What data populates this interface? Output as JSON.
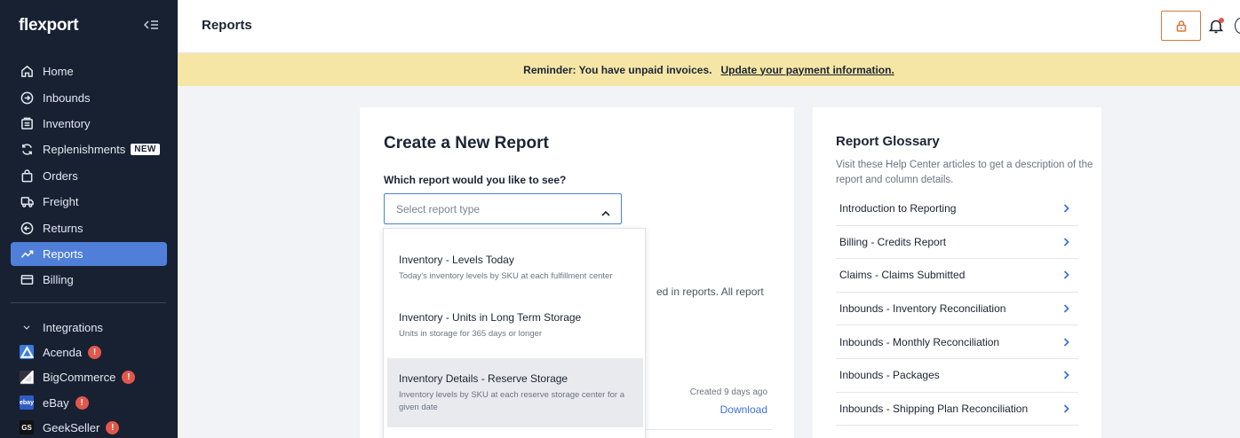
{
  "app": {
    "brand": "flexport"
  },
  "header": {
    "title": "Reports"
  },
  "banner": {
    "text": "Reminder: You have unpaid invoices.",
    "link": "Update your payment information."
  },
  "sidebar": {
    "items": [
      {
        "label": "Home",
        "icon": "home-icon"
      },
      {
        "label": "Inbounds",
        "icon": "inbound-icon"
      },
      {
        "label": "Inventory",
        "icon": "inventory-icon"
      },
      {
        "label": "Replenishments",
        "icon": "replenish-icon",
        "badge": "NEW"
      },
      {
        "label": "Orders",
        "icon": "bag-icon"
      },
      {
        "label": "Freight",
        "icon": "truck-icon"
      },
      {
        "label": "Returns",
        "icon": "returns-icon"
      },
      {
        "label": "Reports",
        "icon": "trend-icon",
        "active": true
      },
      {
        "label": "Billing",
        "icon": "card-icon"
      }
    ],
    "integrations_label": "Integrations",
    "integrations": [
      {
        "label": "Acenda",
        "logo_color": "#3b7de0"
      },
      {
        "label": "BigCommerce",
        "logo_color": "#34313f"
      },
      {
        "label": "eBay",
        "logo_color": "#2f5cc8"
      },
      {
        "label": "GeekSeller",
        "logo_text": "GS",
        "logo_color": "#111111"
      }
    ],
    "alert_mark": "!"
  },
  "create": {
    "title": "Create a New Report",
    "question": "Which report would you like to see?",
    "placeholder": "Select report type",
    "peek_text": "ed in reports. All report",
    "created": "Created 9 days ago",
    "download": "Download"
  },
  "dropdown": {
    "options": [
      {
        "title": "Inventory - Levels Today",
        "desc": "Today's inventory levels by SKU at each fulfillment center"
      },
      {
        "title": "Inventory - Units in Long Term Storage",
        "desc": "Units in storage for 365 days or longer"
      },
      {
        "title": "Inventory Details - Reserve Storage",
        "desc": "Inventory levels by SKU at each reserve storage center for a given date",
        "highlighted": true
      }
    ]
  },
  "glossary": {
    "title": "Report Glossary",
    "desc": "Visit these Help Center articles to get a description of the report and column details.",
    "items": [
      "Introduction to Reporting",
      "Billing - Credits Report",
      "Claims - Claims Submitted",
      "Inbounds - Inventory Reconciliation",
      "Inbounds - Monthly Reconciliation",
      "Inbounds - Packages",
      "Inbounds - Shipping Plan Reconciliation"
    ]
  },
  "colors": {
    "sidebar_bg": "#172132",
    "accent": "#4f7fd8",
    "banner": "#f6e6a6",
    "alert": "#e2574c",
    "lock": "#d27a3c"
  }
}
